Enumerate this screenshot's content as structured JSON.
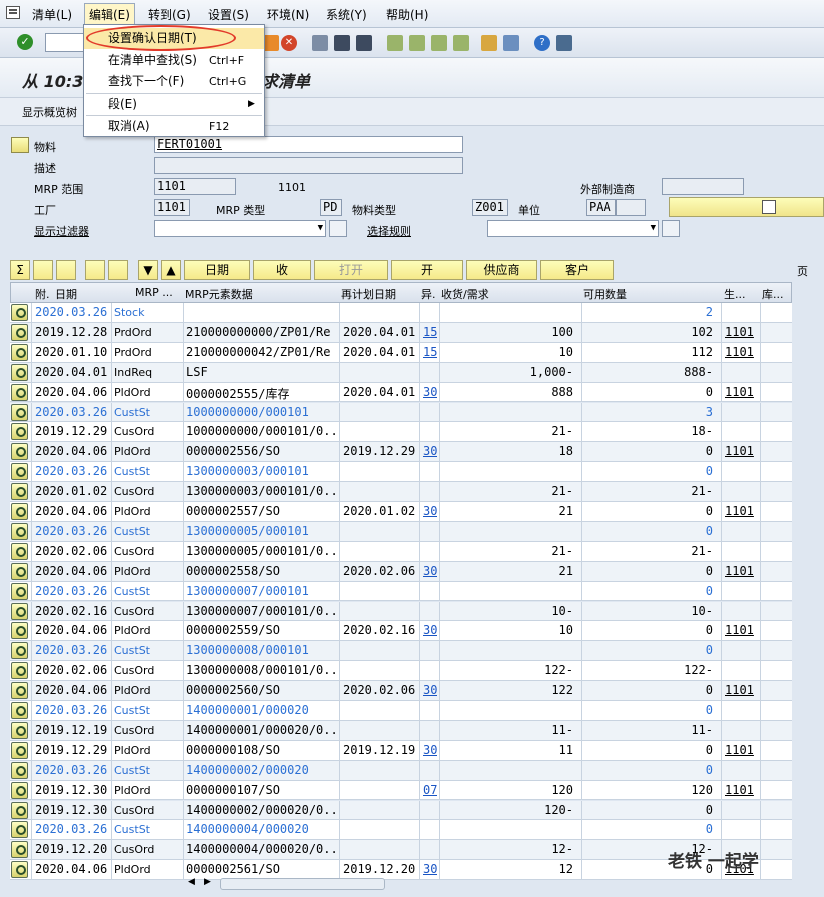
{
  "menu": {
    "items": [
      "清单(L)",
      "编辑(E)",
      "转到(G)",
      "设置(S)",
      "环境(N)",
      "系统(Y)",
      "帮助(H)"
    ]
  },
  "edit_menu": {
    "items": [
      {
        "label": "设置确认日期(T)",
        "shortcut": ""
      },
      {
        "label": "在清单中查找(S)",
        "shortcut": "Ctrl+F"
      },
      {
        "label": "查找下一个(F)",
        "shortcut": "Ctrl+G"
      },
      {
        "label": "段(E)",
        "shortcut": ""
      },
      {
        "label": "取消(A)",
        "shortcut": "F12"
      }
    ]
  },
  "title": {
    "part1": "从 10:3",
    "part2": "求清单"
  },
  "appbar": {
    "button": "显示概览树"
  },
  "header": {
    "material_label": "物料",
    "material_value": "FERT01001",
    "desc_label": "描述",
    "desc_value": "",
    "mrp_area_label": "MRP 范围",
    "mrp_area_value": "1101",
    "mrp_area_text": "1101",
    "ext_vendor_label": "外部制造商",
    "plant_label": "工厂",
    "plant_value": "1101",
    "mrp_type_label": "MRP 类型",
    "mrp_type_value": "PD",
    "mat_type_label": "物料类型",
    "mat_type_value": "Z001",
    "unit_label": "单位",
    "unit_value": "PAA",
    "filter_label": "显示过滤器",
    "sel_rule_label": "选择规则"
  },
  "grid_toolbar": {
    "date_btn": "日期",
    "receipt_btn": "收",
    "print_btn": "打开",
    "open_btn": "开",
    "vendor_btn": "供应商",
    "customer_btn": "客户",
    "page_label": "页"
  },
  "table": {
    "headers": [
      "附.",
      "日期",
      "MRP ...",
      "MRP元素数据",
      "再计划日期",
      "异.",
      "收货/需求",
      "可用数量",
      "生...",
      "库..."
    ],
    "rows": [
      {
        "date": "2020.03.26",
        "mrp": "Stock",
        "data": "",
        "resched": "",
        "exc": "",
        "qty": "",
        "avail": "2",
        "prod": "",
        "blue": true
      },
      {
        "date": "2019.12.28",
        "mrp": "PrdOrd",
        "data": "210000000000/ZP01/Re",
        "resched": "2020.04.01",
        "exc": "15",
        "qty": "100",
        "avail": "102",
        "prod": "1101",
        "blue": false
      },
      {
        "date": "2020.01.10",
        "mrp": "PrdOrd",
        "data": "210000000042/ZP01/Re",
        "resched": "2020.04.01",
        "exc": "15",
        "qty": "10",
        "avail": "112",
        "prod": "1101",
        "blue": false
      },
      {
        "date": "2020.04.01",
        "mrp": "IndReq",
        "data": "LSF",
        "resched": "",
        "exc": "",
        "qty": "1,000-",
        "avail": "888-",
        "prod": "",
        "blue": false
      },
      {
        "date": "2020.04.06",
        "mrp": "PldOrd",
        "data": "0000002555/库存",
        "resched": "2020.04.01",
        "exc": "30",
        "qty": "888",
        "avail": "0",
        "prod": "1101",
        "blue": false
      },
      {
        "date": "2020.03.26",
        "mrp": "CustSt",
        "data": "1000000000/000101",
        "resched": "",
        "exc": "",
        "qty": "",
        "avail": "3",
        "prod": "",
        "blue": true
      },
      {
        "date": "2019.12.29",
        "mrp": "CusOrd",
        "data": "1000000000/000101/0...",
        "resched": "",
        "exc": "",
        "qty": "21-",
        "avail": "18-",
        "prod": "",
        "blue": false
      },
      {
        "date": "2020.04.06",
        "mrp": "PldOrd",
        "data": "0000002556/SO",
        "resched": "2019.12.29",
        "exc": "30",
        "qty": "18",
        "avail": "0",
        "prod": "1101",
        "blue": false
      },
      {
        "date": "2020.03.26",
        "mrp": "CustSt",
        "data": "1300000003/000101",
        "resched": "",
        "exc": "",
        "qty": "",
        "avail": "0",
        "prod": "",
        "blue": true
      },
      {
        "date": "2020.01.02",
        "mrp": "CusOrd",
        "data": "1300000003/000101/0...",
        "resched": "",
        "exc": "",
        "qty": "21-",
        "avail": "21-",
        "prod": "",
        "blue": false
      },
      {
        "date": "2020.04.06",
        "mrp": "PldOrd",
        "data": "0000002557/SO",
        "resched": "2020.01.02",
        "exc": "30",
        "qty": "21",
        "avail": "0",
        "prod": "1101",
        "blue": false
      },
      {
        "date": "2020.03.26",
        "mrp": "CustSt",
        "data": "1300000005/000101",
        "resched": "",
        "exc": "",
        "qty": "",
        "avail": "0",
        "prod": "",
        "blue": true
      },
      {
        "date": "2020.02.06",
        "mrp": "CusOrd",
        "data": "1300000005/000101/0...",
        "resched": "",
        "exc": "",
        "qty": "21-",
        "avail": "21-",
        "prod": "",
        "blue": false
      },
      {
        "date": "2020.04.06",
        "mrp": "PldOrd",
        "data": "0000002558/SO",
        "resched": "2020.02.06",
        "exc": "30",
        "qty": "21",
        "avail": "0",
        "prod": "1101",
        "blue": false
      },
      {
        "date": "2020.03.26",
        "mrp": "CustSt",
        "data": "1300000007/000101",
        "resched": "",
        "exc": "",
        "qty": "",
        "avail": "0",
        "prod": "",
        "blue": true
      },
      {
        "date": "2020.02.16",
        "mrp": "CusOrd",
        "data": "1300000007/000101/0...",
        "resched": "",
        "exc": "",
        "qty": "10-",
        "avail": "10-",
        "prod": "",
        "blue": false
      },
      {
        "date": "2020.04.06",
        "mrp": "PldOrd",
        "data": "0000002559/SO",
        "resched": "2020.02.16",
        "exc": "30",
        "qty": "10",
        "avail": "0",
        "prod": "1101",
        "blue": false
      },
      {
        "date": "2020.03.26",
        "mrp": "CustSt",
        "data": "1300000008/000101",
        "resched": "",
        "exc": "",
        "qty": "",
        "avail": "0",
        "prod": "",
        "blue": true
      },
      {
        "date": "2020.02.06",
        "mrp": "CusOrd",
        "data": "1300000008/000101/0...",
        "resched": "",
        "exc": "",
        "qty": "122-",
        "avail": "122-",
        "prod": "",
        "blue": false
      },
      {
        "date": "2020.04.06",
        "mrp": "PldOrd",
        "data": "0000002560/SO",
        "resched": "2020.02.06",
        "exc": "30",
        "qty": "122",
        "avail": "0",
        "prod": "1101",
        "blue": false
      },
      {
        "date": "2020.03.26",
        "mrp": "CustSt",
        "data": "1400000001/000020",
        "resched": "",
        "exc": "",
        "qty": "",
        "avail": "0",
        "prod": "",
        "blue": true
      },
      {
        "date": "2019.12.19",
        "mrp": "CusOrd",
        "data": "1400000001/000020/0...",
        "resched": "",
        "exc": "",
        "qty": "11-",
        "avail": "11-",
        "prod": "",
        "blue": false
      },
      {
        "date": "2019.12.29",
        "mrp": "PldOrd",
        "data": "0000000108/SO",
        "resched": "2019.12.19",
        "exc": "30",
        "qty": "11",
        "avail": "0",
        "prod": "1101",
        "blue": false
      },
      {
        "date": "2020.03.26",
        "mrp": "CustSt",
        "data": "1400000002/000020",
        "resched": "",
        "exc": "",
        "qty": "",
        "avail": "0",
        "prod": "",
        "blue": true
      },
      {
        "date": "2019.12.30",
        "mrp": "PldOrd",
        "data": "0000000107/SO",
        "resched": "",
        "exc": "07",
        "qty": "120",
        "avail": "120",
        "prod": "1101",
        "blue": false
      },
      {
        "date": "2019.12.30",
        "mrp": "CusOrd",
        "data": "1400000002/000020/0...",
        "resched": "",
        "exc": "",
        "qty": "120-",
        "avail": "0",
        "prod": "",
        "blue": false
      },
      {
        "date": "2020.03.26",
        "mrp": "CustSt",
        "data": "1400000004/000020",
        "resched": "",
        "exc": "",
        "qty": "",
        "avail": "0",
        "prod": "",
        "blue": true
      },
      {
        "date": "2019.12.20",
        "mrp": "CusOrd",
        "data": "1400000004/000020/0...",
        "resched": "",
        "exc": "",
        "qty": "12-",
        "avail": "12-",
        "prod": "",
        "blue": false
      },
      {
        "date": "2020.04.06",
        "mrp": "PldOrd",
        "data": "0000002561/SO",
        "resched": "2019.12.20",
        "exc": "30",
        "qty": "12",
        "avail": "0",
        "prod": "1101",
        "blue": false
      }
    ]
  },
  "watermark": "老铁 一起学"
}
